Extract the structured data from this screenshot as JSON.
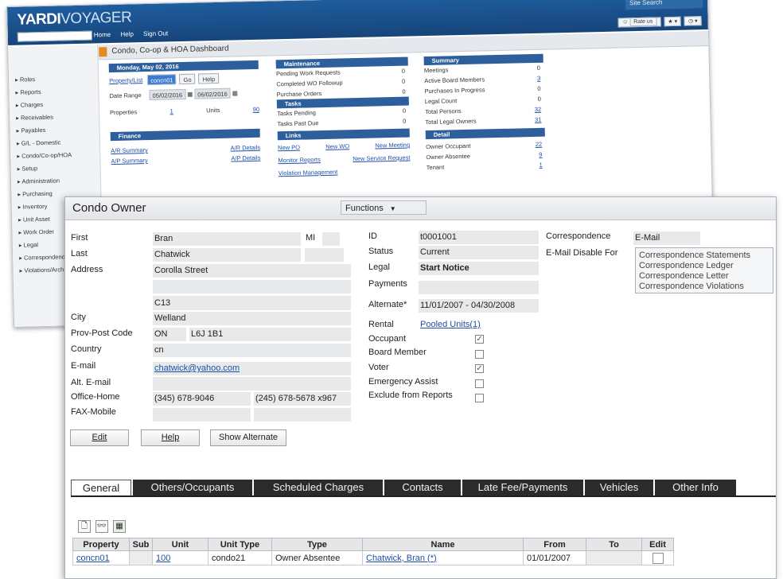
{
  "dashboard": {
    "logo": {
      "bold": "YARDI",
      "light": "VOYAGER"
    },
    "site_search": "Site Search",
    "nav": [
      "Home",
      "Help",
      "Sign Out"
    ],
    "rate_label": "Rate us",
    "title": "Condo, Co-op & HOA Dashboard",
    "sidebar": [
      "Roles",
      "Reports",
      "Charges",
      "Receivables",
      "Payables",
      "G/L - Domestic",
      "Condo/Co-op/HOA",
      "Setup",
      "Administration",
      "Purchasing",
      "Inventory",
      "Unit Asset",
      "Work Order",
      "Legal",
      "Correspondence",
      "Violations/Arch"
    ],
    "date_header": "Monday, May 02, 2016",
    "property_list": "Property/List",
    "property_value": "concn01",
    "go": "Go",
    "help": "Help",
    "date_range_label": "Date Range",
    "date_from": "05/02/2016",
    "date_to": "06/02/2016",
    "properties_label": "Properties",
    "properties_value": "1",
    "units_label": "Units",
    "units_value": "90",
    "finance_header": "Finance",
    "finance_links": [
      "A/R Summary",
      "A/R Details",
      "A/P Summary",
      "A/P Details"
    ],
    "maintenance_header": "Maintenance",
    "maintenance": [
      {
        "label": "Pending Work Requests",
        "value": "0"
      },
      {
        "label": "Completed WO Followup",
        "value": "0"
      },
      {
        "label": "Purchase Orders",
        "value": "0"
      }
    ],
    "tasks_header": "Tasks",
    "tasks": [
      {
        "label": "Tasks Pending",
        "value": "0"
      },
      {
        "label": "Tasks Past Due",
        "value": "0"
      }
    ],
    "links_header": "Links",
    "links": [
      "New PO",
      "New WO",
      "New Meeting",
      "Monitor Reports",
      "New Service Request",
      "Violation Management"
    ],
    "summary_header": "Summary",
    "summary": [
      {
        "label": "Meetings",
        "value": "0"
      },
      {
        "label": "Active Board Members",
        "value": "3"
      },
      {
        "label": "Purchases In Progress",
        "value": "0"
      },
      {
        "label": "Legal Count",
        "value": "0"
      },
      {
        "label": "Total Persons",
        "value": "32"
      },
      {
        "label": "Total Legal Owners",
        "value": "31"
      }
    ],
    "detail_header": "Detail",
    "detail": [
      {
        "label": "Owner Occupant",
        "value": "22"
      },
      {
        "label": "Owner Absentee",
        "value": "9"
      },
      {
        "label": "Tenant",
        "value": "1"
      }
    ]
  },
  "owner": {
    "title": "Condo Owner",
    "functions_label": "Functions",
    "labels": {
      "first": "First",
      "mi": "MI",
      "last": "Last",
      "address": "Address",
      "city": "City",
      "prov": "Prov-Post Code",
      "country": "Country",
      "email": "E-mail",
      "alt_email": "Alt. E-mail",
      "office_home": "Office-Home",
      "fax_mobile": "FAX-Mobile",
      "id": "ID",
      "status": "Status",
      "legal": "Legal",
      "payments": "Payments",
      "alternate": "Alternate*",
      "rental": "Rental",
      "occupant": "Occupant",
      "board_member": "Board Member",
      "voter": "Voter",
      "emergency_assist": "Emergency Assist",
      "exclude": "Exclude from Reports",
      "correspondence": "Correspondence",
      "email_disable": "E-Mail Disable For"
    },
    "values": {
      "first": "Bran",
      "last": "Chatwick",
      "address1": "Corolla Street",
      "address4": "C13",
      "city": "Welland",
      "prov": "ON",
      "post": "L6J 1B1",
      "country": "cn",
      "email": "chatwick@yahoo.com",
      "office": "(345) 678-9046",
      "home": "(245) 678-5678 x967",
      "id": "t0001001",
      "status": "Current",
      "legal": "Start Notice",
      "alternate": "11/01/2007 - 04/30/2008",
      "rental": "Pooled Units(1)",
      "correspondence": "E-Mail"
    },
    "checks": {
      "occupant": true,
      "board_member": false,
      "voter": true,
      "emergency_assist": false,
      "exclude": false
    },
    "disable_for": [
      "Correspondence Statements",
      "Correspondence Ledger",
      "Correspondence Letter",
      "Correspondence Violations"
    ],
    "buttons": {
      "edit": "Edit",
      "help": "Help",
      "show_alternate": "Show Alternate"
    },
    "tabs": [
      "General",
      "Others/Occupants",
      "Scheduled Charges",
      "Contacts",
      "Late Fee/Payments",
      "Vehicles",
      "Other Info"
    ],
    "table": {
      "headers": [
        "Property",
        "Sub",
        "Unit",
        "Unit Type",
        "Type",
        "Name",
        "From",
        "To",
        "Edit"
      ],
      "row": {
        "property": "concn01",
        "sub": "",
        "unit": "100",
        "unit_type": "condo21",
        "type": "Owner Absentee",
        "name": "Chatwick, Bran (*)",
        "from": "01/01/2007",
        "to": ""
      }
    }
  }
}
